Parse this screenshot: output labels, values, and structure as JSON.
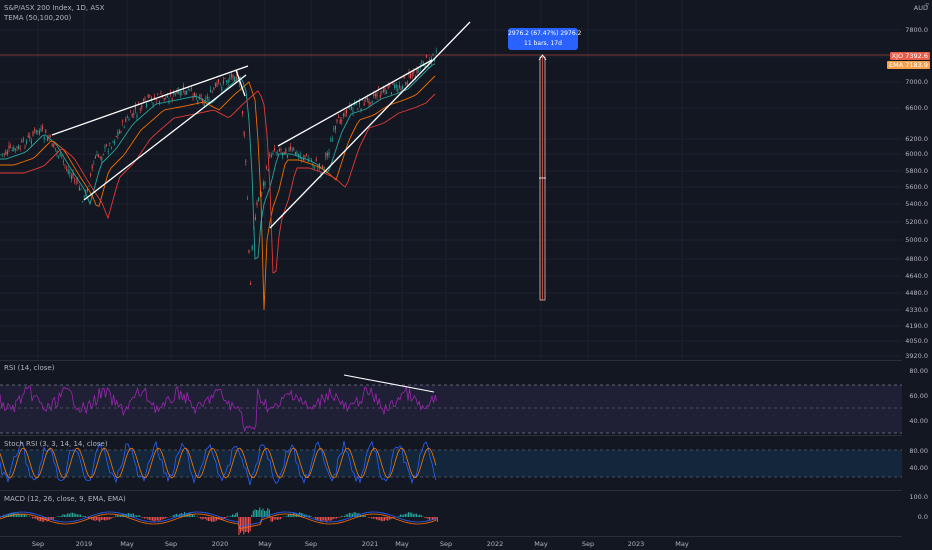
{
  "main": {
    "title": "S&P/ASX 200 Index, 1D, ASX",
    "indicator": "TEMA (50,100,200)",
    "currency": "AUD",
    "price_ticks": [
      "7800.0",
      "7400.0",
      "7000.0",
      "6600.0",
      "6200.0",
      "6000.0",
      "5800.0",
      "5600.0",
      "5400.0",
      "5200.0",
      "5000.0",
      "4800.0",
      "4640.0",
      "4480.0",
      "4330.0",
      "4190.0",
      "4050.0",
      "3920.0"
    ],
    "symbol_badge": "XJO",
    "price_badge": "7392.6",
    "ema_badge": "7183.9",
    "ema_badge_label": "EMA",
    "measure_line1": "2976.2 (67.47%) 2976.2",
    "measure_line2": "11 bars, 17d"
  },
  "rsi": {
    "label": "RSI (14, close)",
    "ticks": [
      "80.00",
      "60.00",
      "40.00"
    ]
  },
  "stoch": {
    "label": "Stoch RSI (3, 3, 14, 14, close)",
    "ticks": [
      "80.00",
      "40.00"
    ]
  },
  "macd": {
    "label": "MACD (12, 26, close, 9, EMA, EMA)",
    "ticks": [
      "100.0",
      "0.0"
    ]
  },
  "time_axis": [
    "Sep",
    "2019",
    "May",
    "Sep",
    "2020",
    "May",
    "Sep",
    "2021",
    "May",
    "Sep",
    "2022",
    "May",
    "Sep",
    "2023",
    "May"
  ],
  "colors": {
    "background": "#131722",
    "price": "#b2b5be",
    "tema_teal": "#26a69a",
    "tema_orange": "#ef6c00",
    "tema_red": "#e53935",
    "rsi": "#9c27b0",
    "stoch_k": "#2962ff",
    "stoch_d": "#f57c00",
    "measure": "#2962ff"
  }
}
